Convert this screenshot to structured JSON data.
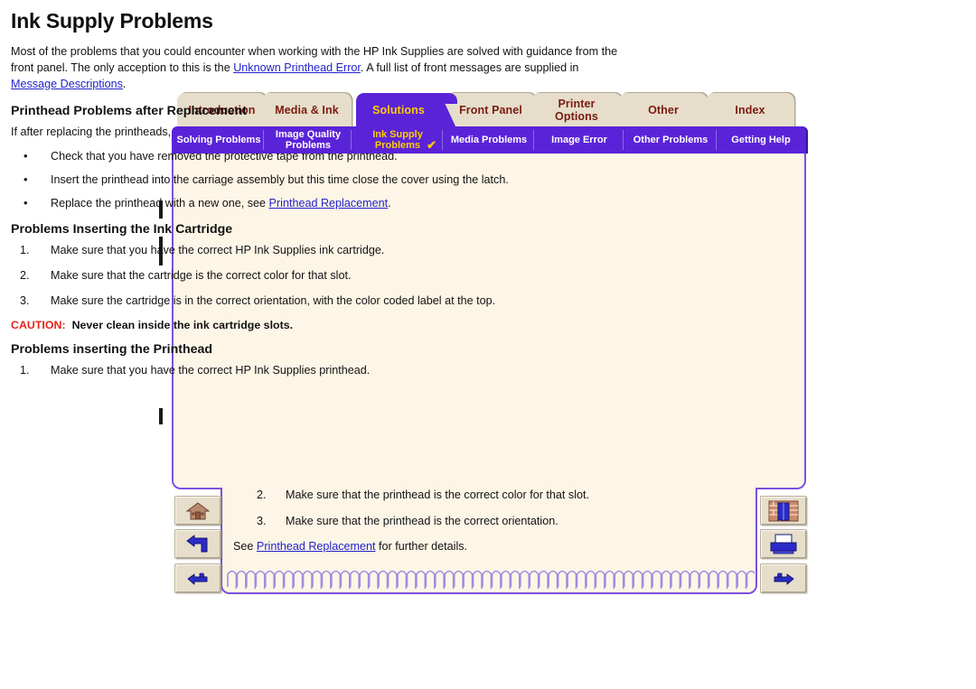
{
  "document": {
    "title": "Ink Supply Problems"
  },
  "main_tabs": [
    {
      "label": "Introduction",
      "active": false
    },
    {
      "label": "Media & Ink",
      "active": false
    },
    {
      "label": "Solutions",
      "active": true
    },
    {
      "label": "Front Panel",
      "active": false
    },
    {
      "label": "Printer Options",
      "line1": "Printer",
      "line2": "Options",
      "active": false
    },
    {
      "label": "Other",
      "active": false
    },
    {
      "label": "Index",
      "active": false
    }
  ],
  "sub_tabs": [
    {
      "label": "Solving Problems",
      "line1": "Solving Problems",
      "line2": "",
      "active": false,
      "checked": false
    },
    {
      "label": "Image Quality Problems",
      "line1": "Image Quality",
      "line2": "Problems",
      "active": false,
      "checked": false
    },
    {
      "label": "Ink Supply Problems",
      "line1": "Ink Supply",
      "line2": "Problems",
      "active": true,
      "checked": true
    },
    {
      "label": "Media Problems",
      "line1": "Media Problems",
      "line2": "",
      "active": false,
      "checked": false
    },
    {
      "label": "Image Error",
      "line1": "Image Error",
      "line2": "",
      "active": false,
      "checked": false
    },
    {
      "label": "Other Problems",
      "line1": "Other Problems",
      "line2": "",
      "active": false,
      "checked": false
    },
    {
      "label": "Getting Help",
      "line1": "Getting Help",
      "line2": "",
      "active": false,
      "checked": false
    }
  ],
  "checkmark_glyph": "✔",
  "content": {
    "heading": "Ink Supply Problems",
    "intro_part1": "Most of the problems that you could encounter when working with the HP Ink Supplies are solved with guidance from the front panel. The only acception to this is the ",
    "intro_link1": "Unknown Printhead Error",
    "intro_part2": ". A full list of front messages are supplied in ",
    "intro_link2": "Message Descriptions",
    "intro_part3": ".",
    "section1_heading": "Printhead Problems after Replacement",
    "section1_intro": "If after replacing the printheads, the printer complains about wrong or missing printheads,, perform the following steps:",
    "section1_bullets": [
      {
        "text": "Check that you have removed the protective tape from the printhead.",
        "link": "",
        "tail": ""
      },
      {
        "text": "Insert the printhead into the carriage assembly but this time close the cover using the latch.",
        "link": "",
        "tail": ""
      },
      {
        "text": "Replace the printhead with a new one, see ",
        "link": "Printhead Replacement",
        "tail": "."
      }
    ],
    "bullet_glyph": "•",
    "section2_heading": "Problems Inserting the Ink Cartridge",
    "section2_items": [
      {
        "num": "1.",
        "text": "Make sure that you have the correct HP Ink Supplies ink cartridge."
      },
      {
        "num": "2.",
        "text": "Make sure that the cartridge is the correct color for that slot."
      },
      {
        "num": "3.",
        "text": "Make sure the cartridge is in the correct orientation, with the color coded label at the top."
      }
    ],
    "caution_word": "CAUTION:",
    "caution_text": "Never clean inside the ink cartridge slots.",
    "section3_heading": "Problems inserting the Printhead",
    "section3_item1": {
      "num": "1.",
      "text": "Make sure that you have the correct HP Ink Supplies printhead."
    },
    "section3_items_lower": [
      {
        "num": "2.",
        "text": "Make sure that the printhead is the correct color for that slot."
      },
      {
        "num": "3.",
        "text": "Make sure that the printhead is the correct orientation."
      }
    ],
    "see_also_prefix": "See ",
    "see_also_link": "Printhead Replacement",
    "see_also_suffix": " for further details."
  },
  "nav_left": [
    {
      "icon": "home-icon",
      "name": "home-button"
    },
    {
      "icon": "back-arrow-icon",
      "name": "back-button"
    },
    {
      "icon": "pointing-hand-left-icon",
      "name": "previous-page-button"
    }
  ],
  "nav_right": [
    {
      "icon": "bookshelf-icon",
      "name": "library-button"
    },
    {
      "icon": "printer-icon",
      "name": "print-button"
    },
    {
      "icon": "pointing-hand-right-icon",
      "name": "next-page-button"
    }
  ],
  "colors": {
    "active_tab": "#5A23D8",
    "inactive_tab": "#E6DECB",
    "inactive_tab_text": "#7B1A10",
    "active_tab_text": "#FFCC00",
    "page_background": "#FDF6E7",
    "panel_border": "#7B4FE0",
    "link": "#2222CC",
    "caution": "#E8241C",
    "spiral": "#9B8FE0"
  }
}
